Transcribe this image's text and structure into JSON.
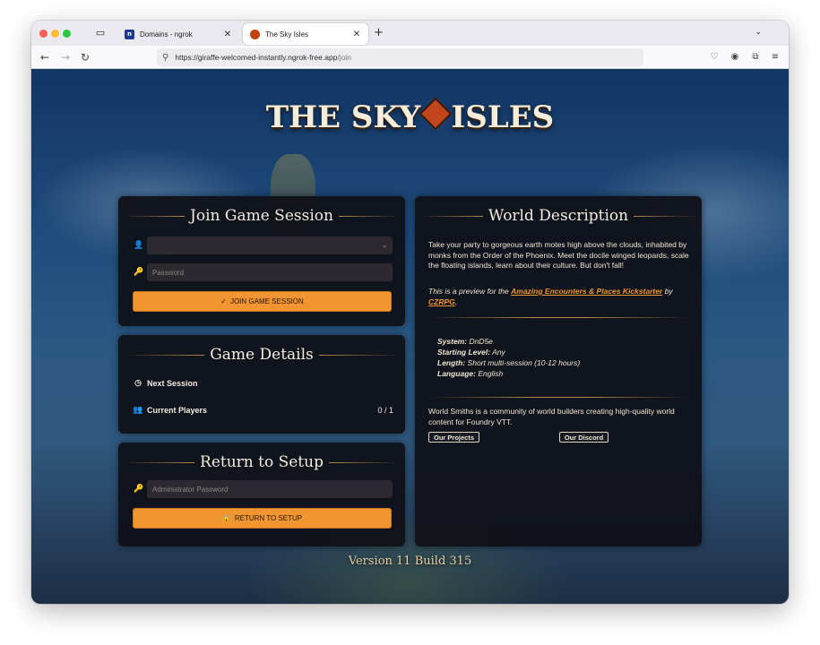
{
  "browser": {
    "tabs": [
      {
        "label": "Domains - ngrok",
        "favicon": "n"
      },
      {
        "label": "The Sky Isles",
        "favicon": ""
      }
    ],
    "url_main": "https://giraffe-welcomed-instantly.ngrok-free.app",
    "url_path": "/join"
  },
  "logo": {
    "text_left": "THE SKY",
    "text_right": "ISLES"
  },
  "join": {
    "title": "Join Game Session",
    "user_value": "",
    "password_placeholder": "Password",
    "button_label": "JOIN GAME SESSION"
  },
  "details": {
    "title": "Game Details",
    "next_session_label": "Next Session",
    "players_label": "Current Players",
    "players_value": "0 / 1"
  },
  "setup": {
    "title": "Return to Setup",
    "password_placeholder": "Administrator Password",
    "button_label": "RETURN TO SETUP"
  },
  "world": {
    "title": "World Description",
    "description": "Take your party to gorgeous earth motes high above the clouds, inhabited by monks from the Order of the Phoenix. Meet the docile winged leopards, scale the floating islands, learn about their culture. But don't fall!",
    "preview_prefix": "This is a preview for the ",
    "preview_link": "Amazing Encounters & Places Kickstarter",
    "preview_mid": " by ",
    "preview_link2": "CZRPG",
    "preview_suffix": ".",
    "specs": [
      {
        "label": "System:",
        "value": "DnD5e"
      },
      {
        "label": "Starting Level:",
        "value": "Any"
      },
      {
        "label": "Length:",
        "value": "Short multi-session (10-12 hours)"
      },
      {
        "label": "Language:",
        "value": "English"
      }
    ],
    "community": "World Smiths is a community of world builders creating high-quality world content for Foundry VTT.",
    "btn_projects": "Our Projects",
    "btn_discord": "Our Discord"
  },
  "version": "Version 11 Build 315",
  "colors": {
    "accent": "#f0952f",
    "panel": "#0e0f16",
    "gold": "#b8874a"
  }
}
